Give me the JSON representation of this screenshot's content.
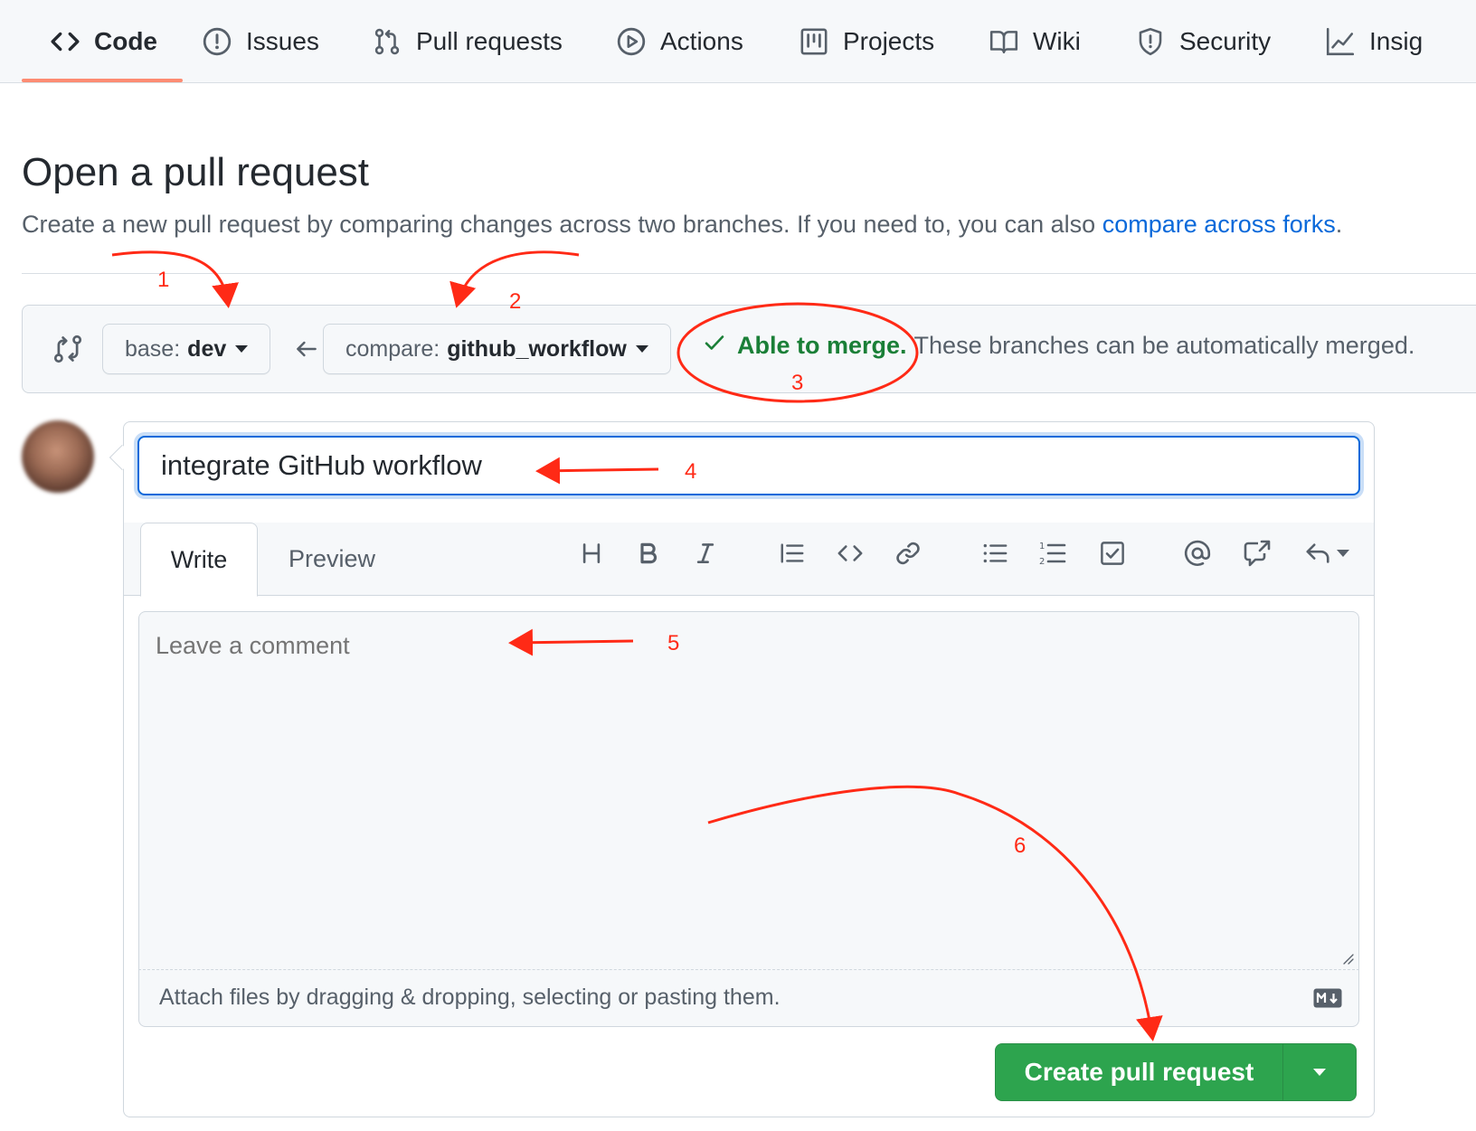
{
  "nav": {
    "tabs": [
      {
        "label": "Code",
        "icon": "code-icon",
        "selected": true
      },
      {
        "label": "Issues",
        "icon": "issue-icon"
      },
      {
        "label": "Pull requests",
        "icon": "pull-request-icon"
      },
      {
        "label": "Actions",
        "icon": "play-icon"
      },
      {
        "label": "Projects",
        "icon": "project-icon"
      },
      {
        "label": "Wiki",
        "icon": "book-icon"
      },
      {
        "label": "Security",
        "icon": "shield-icon"
      },
      {
        "label": "Insig",
        "icon": "graph-icon"
      }
    ],
    "underline_color": "#fd8c73"
  },
  "page": {
    "title": "Open a pull request",
    "subtitle": "Create a new pull request by comparing changes across two branches. If you need to, you can also ",
    "subtitle_link": "compare across forks",
    "subtitle_end": "."
  },
  "range": {
    "base_prefix": "base:",
    "base_branch": "dev",
    "compare_prefix": "compare:",
    "compare_branch": "github_workflow",
    "merge_ok": "Able to merge.",
    "merge_text": "These branches can be automatically merged."
  },
  "form": {
    "title_value": "integrate GitHub workflow",
    "tabs": {
      "write": "Write",
      "preview": "Preview"
    },
    "toolbar": [
      "heading-icon",
      "bold-icon",
      "italic-icon",
      "quote-icon",
      "code-icon",
      "link-icon",
      "unordered-list-icon",
      "ordered-list-icon",
      "task-list-icon",
      "mention-icon",
      "cross-reference-icon",
      "reply-icon"
    ],
    "comment_placeholder": "Leave a comment",
    "attach_text": "Attach files by dragging & dropping, selecting or pasting them.",
    "submit_label": "Create pull request"
  },
  "annotations": {
    "numbers": [
      "1",
      "2",
      "3",
      "4",
      "5",
      "6"
    ],
    "color": "#ff2a16"
  },
  "colors": {
    "link": "#0969da",
    "success": "#1a7f37",
    "button_green": "#2da44e",
    "focus_blue": "#0969da"
  }
}
